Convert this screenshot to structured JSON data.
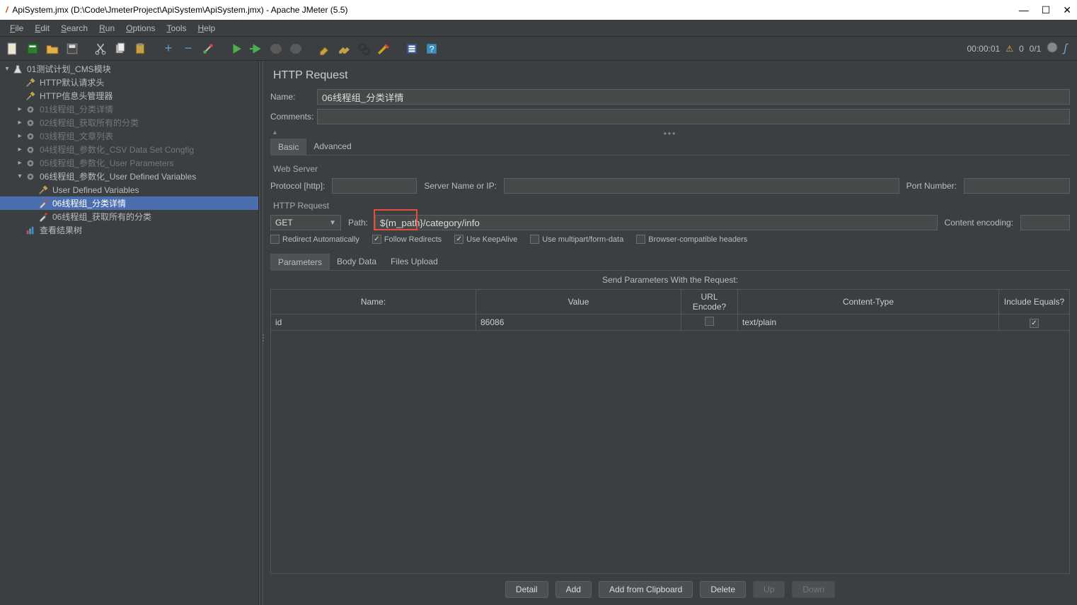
{
  "window": {
    "title": "ApiSystem.jmx (D:\\Code\\JmeterProject\\ApiSystem\\ApiSystem.jmx) - Apache JMeter (5.5)"
  },
  "menu": {
    "file": "File",
    "edit": "Edit",
    "search": "Search",
    "run": "Run",
    "options": "Options",
    "tools": "Tools",
    "help": "Help"
  },
  "status": {
    "time": "00:00:01",
    "errors": "0",
    "threads": "0/1"
  },
  "tree": [
    {
      "id": "plan",
      "label": "01测试计划_CMS模块",
      "indent": 0,
      "expanded": true,
      "icon": "flask"
    },
    {
      "id": "header",
      "label": "HTTP默认请求头",
      "indent": 1,
      "icon": "wrench"
    },
    {
      "id": "cookie",
      "label": "HTTP信息头管理器",
      "indent": 1,
      "icon": "wrench"
    },
    {
      "id": "tg1",
      "label": "01线程组_分类详情",
      "indent": 1,
      "icon": "gear",
      "disabled": true,
      "collapsed": true
    },
    {
      "id": "tg2",
      "label": "02线程组_获取所有的分类",
      "indent": 1,
      "icon": "gear",
      "disabled": true,
      "collapsed": true
    },
    {
      "id": "tg3",
      "label": "03线程组_文章列表",
      "indent": 1,
      "icon": "gear",
      "disabled": true,
      "collapsed": true
    },
    {
      "id": "tg4",
      "label": "04线程组_参数化_CSV Data Set Congfig",
      "indent": 1,
      "icon": "gear",
      "disabled": true,
      "collapsed": true
    },
    {
      "id": "tg5",
      "label": "05线程组_参数化_User Parameters",
      "indent": 1,
      "icon": "gear",
      "disabled": true,
      "collapsed": true
    },
    {
      "id": "tg6",
      "label": "06线程组_参数化_User Defined Variables",
      "indent": 1,
      "icon": "gear",
      "expanded": true
    },
    {
      "id": "udv",
      "label": "User Defined Variables",
      "indent": 2,
      "icon": "wrench"
    },
    {
      "id": "req1",
      "label": "06线程组_分类详情",
      "indent": 2,
      "icon": "pipette",
      "selected": true
    },
    {
      "id": "req2",
      "label": "06线程组_获取所有的分类",
      "indent": 2,
      "icon": "pipette"
    },
    {
      "id": "results",
      "label": "查看结果树",
      "indent": 1,
      "icon": "chart"
    }
  ],
  "panel": {
    "heading": "HTTP Request",
    "name_label": "Name:",
    "name_value": "06线程组_分类详情",
    "comments_label": "Comments:",
    "comments_value": "",
    "tabs": {
      "basic": "Basic",
      "advanced": "Advanced"
    },
    "web_server": {
      "section": "Web Server",
      "protocol_label": "Protocol [http]:",
      "protocol_value": "",
      "server_label": "Server Name or IP:",
      "server_value": "",
      "port_label": "Port Number:",
      "port_value": ""
    },
    "http_request": {
      "section": "HTTP Request",
      "method": "GET",
      "path_label": "Path:",
      "path_value": "${m_path}/category/info",
      "encoding_label": "Content encoding:",
      "encoding_value": ""
    },
    "checks": {
      "redirect_auto": "Redirect Automatically",
      "follow_redirects": "Follow Redirects",
      "keepalive": "Use KeepAlive",
      "multipart": "Use multipart/form-data",
      "browser_compat": "Browser-compatible headers"
    },
    "subtabs": {
      "params": "Parameters",
      "body": "Body Data",
      "files": "Files Upload"
    },
    "params_title": "Send Parameters With the Request:",
    "columns": {
      "name": "Name:",
      "value": "Value",
      "url_encode": "URL Encode?",
      "content_type": "Content-Type",
      "include_equals": "Include Equals?"
    },
    "rows": [
      {
        "name": "id",
        "value": "86086",
        "url_encode": false,
        "content_type": "text/plain",
        "include_equals": true
      }
    ],
    "buttons": {
      "detail": "Detail",
      "add": "Add",
      "clipboard": "Add from Clipboard",
      "delete": "Delete",
      "up": "Up",
      "down": "Down"
    }
  }
}
